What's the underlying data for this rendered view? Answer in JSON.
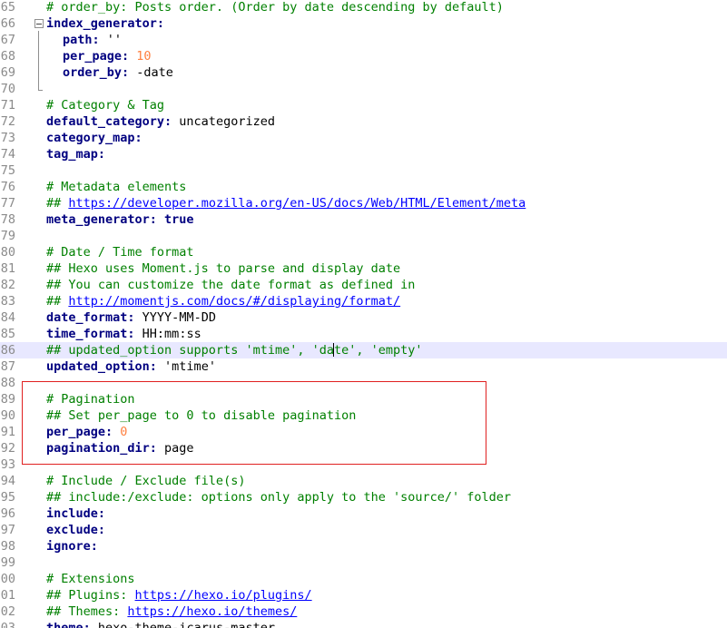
{
  "editor": {
    "current_line": "86",
    "lines": [
      {
        "n": "65",
        "parts": [
          {
            "t": "# order_by: Posts order. (Order by date descending by default)",
            "c": "comment"
          }
        ]
      },
      {
        "n": "66",
        "parts": [
          {
            "t": "index_generator:",
            "c": "key"
          }
        ]
      },
      {
        "n": "67",
        "indent": 1,
        "parts": [
          {
            "t": "path:",
            "c": "key"
          },
          {
            "t": " ''",
            "c": "plain"
          }
        ]
      },
      {
        "n": "68",
        "indent": 1,
        "parts": [
          {
            "t": "per_page:",
            "c": "key"
          },
          {
            "t": " ",
            "c": "plain"
          },
          {
            "t": "10",
            "c": "num"
          }
        ]
      },
      {
        "n": "69",
        "indent": 1,
        "parts": [
          {
            "t": "order_by:",
            "c": "key"
          },
          {
            "t": " -date",
            "c": "plain"
          }
        ]
      },
      {
        "n": "70",
        "parts": []
      },
      {
        "n": "71",
        "parts": [
          {
            "t": "# Category & Tag",
            "c": "comment"
          }
        ]
      },
      {
        "n": "72",
        "parts": [
          {
            "t": "default_category:",
            "c": "key"
          },
          {
            "t": " uncategorized",
            "c": "plain"
          }
        ]
      },
      {
        "n": "73",
        "parts": [
          {
            "t": "category_map:",
            "c": "key"
          }
        ]
      },
      {
        "n": "74",
        "parts": [
          {
            "t": "tag_map:",
            "c": "key"
          }
        ]
      },
      {
        "n": "75",
        "parts": []
      },
      {
        "n": "76",
        "parts": [
          {
            "t": "# Metadata elements",
            "c": "comment"
          }
        ]
      },
      {
        "n": "77",
        "parts": [
          {
            "t": "## ",
            "c": "comment"
          },
          {
            "t": "https://developer.mozilla.org/en-US/docs/Web/HTML/Element/meta",
            "c": "link"
          }
        ]
      },
      {
        "n": "78",
        "parts": [
          {
            "t": "meta_generator:",
            "c": "key"
          },
          {
            "t": " true",
            "c": "key"
          }
        ]
      },
      {
        "n": "79",
        "parts": []
      },
      {
        "n": "80",
        "parts": [
          {
            "t": "# Date / Time format",
            "c": "comment"
          }
        ]
      },
      {
        "n": "81",
        "parts": [
          {
            "t": "## Hexo uses Moment.js to parse and display date",
            "c": "comment"
          }
        ]
      },
      {
        "n": "82",
        "parts": [
          {
            "t": "## You can customize the date format as defined in",
            "c": "comment"
          }
        ]
      },
      {
        "n": "83",
        "parts": [
          {
            "t": "## ",
            "c": "comment"
          },
          {
            "t": "http://momentjs.com/docs/#/displaying/format/",
            "c": "link"
          }
        ]
      },
      {
        "n": "84",
        "parts": [
          {
            "t": "date_format:",
            "c": "key"
          },
          {
            "t": " YYYY-MM-DD",
            "c": "plain"
          }
        ]
      },
      {
        "n": "85",
        "parts": [
          {
            "t": "time_format:",
            "c": "key"
          },
          {
            "t": " HH:mm:ss",
            "c": "plain"
          }
        ]
      },
      {
        "n": "86",
        "parts": [
          {
            "t": "## updated_option supports 'mtime', 'da",
            "c": "comment"
          },
          {
            "t": "",
            "c": "caret"
          },
          {
            "t": "te', 'empty'",
            "c": "comment"
          }
        ]
      },
      {
        "n": "87",
        "parts": [
          {
            "t": "updated_option:",
            "c": "key"
          },
          {
            "t": " 'mtime'",
            "c": "plain"
          }
        ]
      },
      {
        "n": "88",
        "parts": []
      },
      {
        "n": "89",
        "parts": [
          {
            "t": "# Pagination",
            "c": "comment"
          }
        ]
      },
      {
        "n": "90",
        "parts": [
          {
            "t": "## Set per_page to 0 to disable pagination",
            "c": "comment"
          }
        ]
      },
      {
        "n": "91",
        "parts": [
          {
            "t": "per_page:",
            "c": "key"
          },
          {
            "t": " ",
            "c": "plain"
          },
          {
            "t": "0",
            "c": "num"
          }
        ]
      },
      {
        "n": "92",
        "parts": [
          {
            "t": "pagination_dir:",
            "c": "key"
          },
          {
            "t": " page",
            "c": "plain"
          }
        ]
      },
      {
        "n": "93",
        "parts": []
      },
      {
        "n": "94",
        "parts": [
          {
            "t": "# Include / Exclude file(s)",
            "c": "comment"
          }
        ]
      },
      {
        "n": "95",
        "parts": [
          {
            "t": "## include:/exclude: options only apply to the 'source/' folder",
            "c": "comment"
          }
        ]
      },
      {
        "n": "96",
        "parts": [
          {
            "t": "include:",
            "c": "key"
          }
        ]
      },
      {
        "n": "97",
        "parts": [
          {
            "t": "exclude:",
            "c": "key"
          }
        ]
      },
      {
        "n": "98",
        "parts": [
          {
            "t": "ignore:",
            "c": "key"
          }
        ]
      },
      {
        "n": "99",
        "parts": []
      },
      {
        "n": "00",
        "parts": [
          {
            "t": "# Extensions",
            "c": "comment"
          }
        ]
      },
      {
        "n": "01",
        "parts": [
          {
            "t": "## Plugins: ",
            "c": "comment"
          },
          {
            "t": "https://hexo.io/plugins/",
            "c": "link"
          }
        ]
      },
      {
        "n": "02",
        "parts": [
          {
            "t": "## Themes: ",
            "c": "comment"
          },
          {
            "t": "https://hexo.io/themes/",
            "c": "link"
          }
        ]
      },
      {
        "n": "03",
        "parts": [
          {
            "t": "theme:",
            "c": "key"
          },
          {
            "t": " hexo-theme-icarus-master",
            "c": "plain"
          }
        ]
      }
    ]
  },
  "colors": {
    "comment": "#008000",
    "key": "#000080",
    "link": "#0000ff",
    "number": "#ff8040",
    "current_line_bg": "#e8e8ff",
    "highlight_border": "#e02020"
  }
}
